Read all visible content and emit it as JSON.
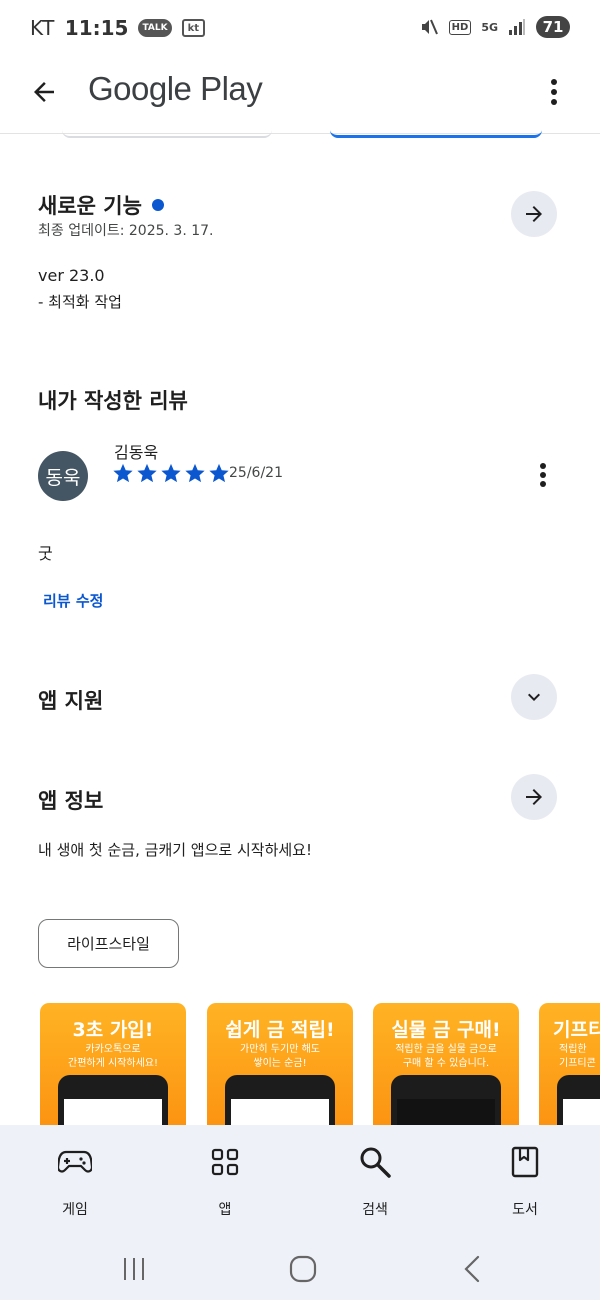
{
  "status_bar": {
    "carrier": "KT",
    "time": "11:15",
    "talk_badge": "TALK",
    "kt_badge": "kt",
    "hd": "HD",
    "network": "5G",
    "battery": "71"
  },
  "app_bar": {
    "title": "Google Play"
  },
  "whats_new": {
    "title": "새로운 기능",
    "updated": "최종 업데이트: 2025. 3. 17.",
    "version": "ver 23.0",
    "note": "- 최적화 작업"
  },
  "my_review": {
    "title": "내가 작성한 리뷰",
    "avatar_text": "동욱",
    "author": "김동욱",
    "rating": 5,
    "date": "25/6/21",
    "text": "굿",
    "edit_label": "리뷰 수정"
  },
  "app_support": {
    "title": "앱 지원"
  },
  "app_info": {
    "title": "앱 정보",
    "description": "내 생애 첫 순금, 금캐기 앱으로 시작하세요!",
    "category": "라이프스타일"
  },
  "screenshots": [
    {
      "title": "3초 가입!",
      "subtitle": "카카오톡으로\n간편하게 시작하세요!"
    },
    {
      "title": "쉽게 금 적립!",
      "subtitle": "가만히 두기만 해도\n쌓이는 순금!"
    },
    {
      "title": "실물 금 구매!",
      "subtitle": "적립한 금을 실물 금으로\n구매 할 수 있습니다."
    },
    {
      "title": "기프티",
      "subtitle": "적립한\n기프티콘"
    }
  ],
  "bottom_nav": [
    {
      "label": "게임",
      "icon": "gamepad-icon"
    },
    {
      "label": "앱",
      "icon": "apps-grid-icon"
    },
    {
      "label": "검색",
      "icon": "search-icon"
    },
    {
      "label": "도서",
      "icon": "book-icon"
    }
  ],
  "colors": {
    "accent": "#0b57d0",
    "button_bg": "#e8eaf2",
    "nav_bg": "#eef2f8",
    "screenshot_orange": "#fb8a0c",
    "avatar_bg": "#445664"
  }
}
